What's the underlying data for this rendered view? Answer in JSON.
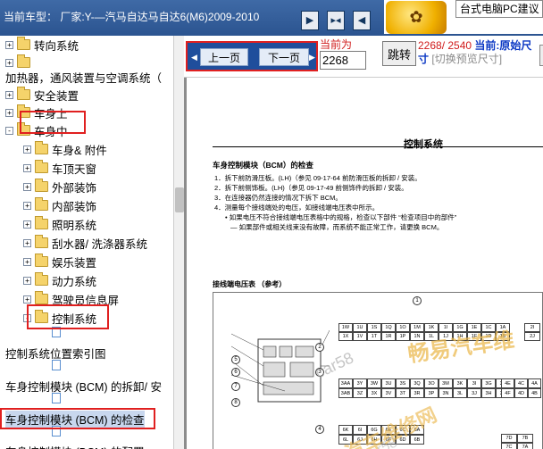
{
  "header": {
    "car_type": "当前车型： 厂家:Y-—汽马自达马自达6(M6)2009-2010",
    "nav_buttons": [
      "next-icon",
      "expand-icon",
      "prev-icon"
    ],
    "ad_text": "台式电脑PC建议",
    "ad_logo_glyph": "✿"
  },
  "tree": {
    "items": [
      {
        "label": "转向系统",
        "expander": "+"
      },
      {
        "label": "",
        "expander": "+"
      },
      {
        "label": "加热器，通风装置与空调系统（",
        "expander": ""
      },
      {
        "label": "安全装置",
        "expander": "+"
      },
      {
        "label": "车身上",
        "expander": "+"
      },
      {
        "label": "车身中",
        "expander": "-"
      },
      {
        "label": "车身& 附件",
        "expander": "+"
      },
      {
        "label": "车顶天窗",
        "expander": "+"
      },
      {
        "label": "外部装饰",
        "expander": "+"
      },
      {
        "label": "内部装饰",
        "expander": "+"
      },
      {
        "label": "照明系统",
        "expander": "+"
      },
      {
        "label": "刮水器/ 洗涤器系统",
        "expander": "+"
      },
      {
        "label": "娱乐装置",
        "expander": "+"
      },
      {
        "label": "动力系统",
        "expander": "+"
      },
      {
        "label": "驾驶员信息屏",
        "expander": "+"
      },
      {
        "label": "控制系统",
        "expander": "-"
      },
      {
        "label": "控制系统位置索引图",
        "expander": ""
      },
      {
        "label": "车身控制模块 (BCM) 的拆卸/ 安",
        "expander": ""
      },
      {
        "label": "车身控制模块 (BCM) 的检查",
        "expander": ""
      },
      {
        "label": "车身控制模块 (BCM) 的配置",
        "expander": ""
      }
    ]
  },
  "pager": {
    "prev_label": "上一页",
    "next_label": "下一页",
    "current_label": "当前为",
    "page_value": "2268",
    "jump_label": "跳转",
    "page_current": "2268",
    "page_total": "2540",
    "current_size_label": "当前:原始尺寸",
    "switch_label": "[切换预览尺寸]"
  },
  "document": {
    "title": "控制系统",
    "subtitle": "车身控制模块（BCM）的检查",
    "steps": [
      "1．拆下前防滑压板。(LH)（参见 09-17-64 前防滑压板的拆卸 / 安装。",
      "2．拆下前侧饰板。(LH)（参见 09-17-49 前侧饰件的拆卸 / 安装。",
      "3．在连接器仍然连接的情况下拆下 BCM。",
      "4．测量每个接线端处的电压，如接线端电压表中所示。",
      "• 如果电压不符合接线端电压表格中的规格，检查以下部件 “检查项目中的部件”",
      "— 如果部件或相关线束没有故障，而系统不能正常工作，请更换 BCM。"
    ],
    "connector_title": "接线端电压表 （参考）",
    "callouts": [
      "1",
      "2",
      "3",
      "4",
      "5",
      "6",
      "7",
      "8"
    ],
    "pins_row1": [
      "1W",
      "1U",
      "1S",
      "1Q",
      "1O",
      "1M",
      "1K",
      "1I",
      "1G",
      "1E",
      "1C",
      "1A"
    ],
    "pins_row2": [
      "1X",
      "1V",
      "1T",
      "1R",
      "1P",
      "1N",
      "1L",
      "1J",
      "1H",
      "1F",
      "1D",
      "1B"
    ],
    "pins_3a": [
      "3AA",
      "3Y",
      "3W",
      "3U",
      "3S",
      "3Q",
      "3O",
      "3M",
      "3K",
      "3I",
      "3G",
      "3E"
    ],
    "pins_3b": [
      "3AB",
      "3Z",
      "3X",
      "3V",
      "3T",
      "3R",
      "3P",
      "3N",
      "3L",
      "3J",
      "3H",
      "3F"
    ],
    "pins_6": [
      "6K",
      "6I",
      "6G",
      "6E",
      "6C",
      "6A",
      "6L",
      "6J",
      "6H",
      "6F",
      "6D",
      "6B"
    ],
    "pins_4": [
      "4E",
      "4C",
      "4A",
      "4F",
      "4D",
      "4B"
    ],
    "pins_7": [
      "7D",
      "7B",
      "7C",
      "7A"
    ],
    "pins_2": [
      "2I",
      "2J"
    ],
    "watermarks": [
      "畅易汽车维",
      "car58",
      "汽车维修网",
      "car58"
    ]
  },
  "colors": {
    "topbar": "#2b5490",
    "highlight_red": "#e02020",
    "page_red": "#d01c1c",
    "page_blue": "#0b38c4"
  }
}
